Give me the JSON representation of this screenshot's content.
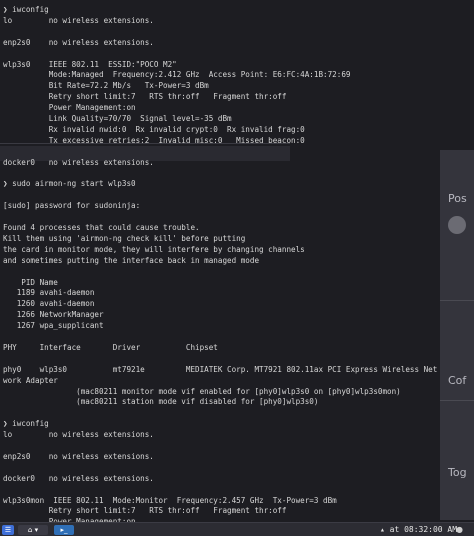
{
  "background_app": {
    "peek_labels": [
      "Pos",
      "Cof",
      "Tog"
    ]
  },
  "terminal": {
    "lines": [
      "❯ iwconfig",
      "lo        no wireless extensions.",
      "",
      "enp2s0    no wireless extensions.",
      "",
      "wlp3s0    IEEE 802.11  ESSID:\"POCO M2\"",
      "          Mode:Managed  Frequency:2.412 GHz  Access Point: E6:FC:4A:1B:72:69",
      "          Bit Rate=72.2 Mb/s   Tx-Power=3 dBm",
      "          Retry short limit:7   RTS thr:off   Fragment thr:off",
      "          Power Management:on",
      "          Link Quality=70/70  Signal level=-35 dBm",
      "          Rx invalid nwid:0  Rx invalid crypt:0  Rx invalid frag:0",
      "          Tx excessive retries:2  Invalid misc:0   Missed beacon:0",
      "",
      "docker0   no wireless extensions.",
      "",
      "❯ sudo airmon-ng start wlp3s0",
      "",
      "[sudo] password for sudoninja:",
      "",
      "Found 4 processes that could cause trouble.",
      "Kill them using 'airmon-ng check kill' before putting",
      "the card in monitor mode, they will interfere by changing channels",
      "and sometimes putting the interface back in managed mode",
      "",
      "    PID Name",
      "   1189 avahi-daemon",
      "   1260 avahi-daemon",
      "   1266 NetworkManager",
      "   1267 wpa_supplicant",
      "",
      "PHY     Interface       Driver          Chipset",
      "",
      "phy0    wlp3s0          mt7921e         MEDIATEK Corp. MT7921 802.11ax PCI Express Wireless Net",
      "work Adapter",
      "                (mac80211 monitor mode vif enabled for [phy0]wlp3s0 on [phy0]wlp3s0mon)",
      "                (mac80211 station mode vif disabled for [phy0]wlp3s0)",
      "",
      "❯ iwconfig",
      "lo        no wireless extensions.",
      "",
      "enp2s0    no wireless extensions.",
      "",
      "docker0   no wireless extensions.",
      "",
      "wlp3s0mon  IEEE 802.11  Mode:Monitor  Frequency:2.457 GHz  Tx-Power=3 dBm",
      "          Retry short limit:7   RTS thr:off   Fragment thr:off",
      "          Power Management:on"
    ]
  },
  "taskbar": {
    "menu_icon": "☰",
    "apps_label": "⌂ ▾",
    "terminal_label": "▸_",
    "clock": "▴ at 08:32:00 AM",
    "tray_icon": "●"
  }
}
